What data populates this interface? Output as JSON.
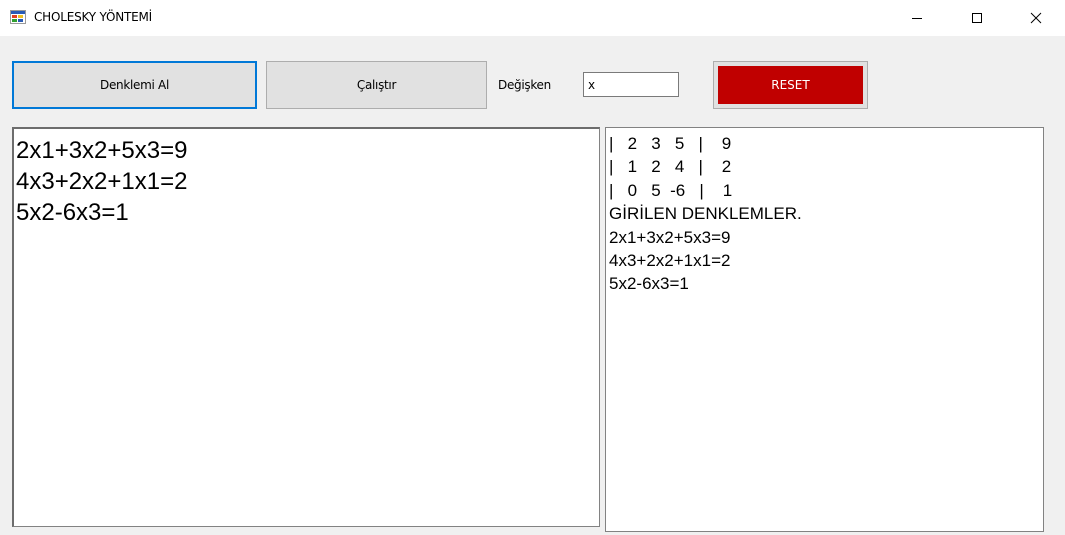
{
  "window": {
    "title": "CHOLESKY YÖNTEMİ",
    "app_icon": "windows-form-icon",
    "controls": {
      "minimize_icon": "minimize-icon",
      "maximize_icon": "maximize-icon",
      "close_icon": "close-icon"
    }
  },
  "toolbar": {
    "get_equation_label": "Denklemi Al",
    "run_label": "Çalıştır",
    "variable_label": "Değişken",
    "variable_value": "x",
    "reset_label": "RESET",
    "reset_color": "#c00000"
  },
  "input_equations": [
    "2x1+3x2+5x3=9",
    "4x3+2x2+1x1=2",
    "5x2-6x3=1"
  ],
  "output_lines": [
    "|   2   3   5   |    9",
    "|   1   2   4   |    2",
    "|   0   5  -6   |    1",
    "GİRİLEN DENKLEMLER.",
    "2x1+3x2+5x3=9",
    "4x3+2x2+1x1=2",
    "5x2-6x3=1"
  ]
}
